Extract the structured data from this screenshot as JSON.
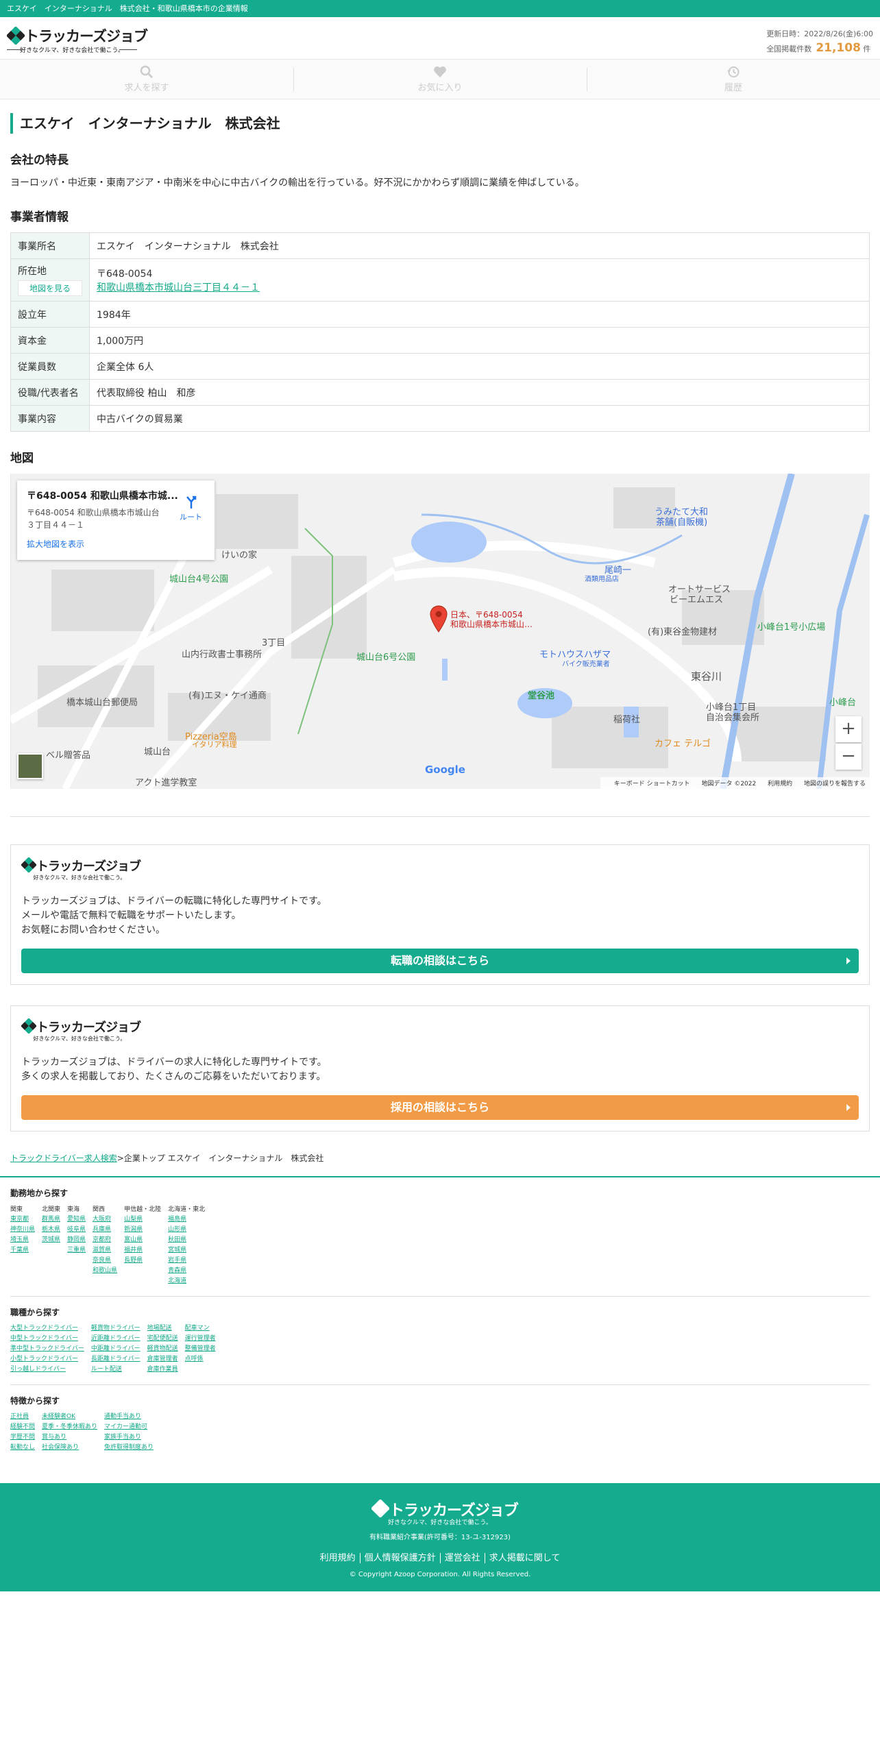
{
  "topbar": {
    "text": "エスケイ　インターナショナル　株式会社・和歌山県橋本市の企業情報"
  },
  "brand": {
    "name": "トラッカーズジョブ",
    "tagline": "好きなクルマ、好きな会社で働こう。",
    "color": "#14ab8f"
  },
  "header": {
    "updated": "更新日時：2022/8/26(金)6:00",
    "count_label": "全国掲載件数",
    "count": "21,108",
    "count_unit": "件"
  },
  "nav": {
    "search": "求人を探す",
    "favorite": "お気に入り",
    "history": "履歴"
  },
  "company": {
    "title": "エスケイ　インターナショナル　株式会社"
  },
  "features": {
    "heading": "会社の特長",
    "text": "ヨーロッパ・中近東・東南アジア・中南米を中心に中古バイクの輸出を行っている。好不況にかかわらず順調に業績を伸ばしている。"
  },
  "info": {
    "heading": "事業者情報",
    "map_button": "地図を見る",
    "rows": [
      {
        "label": "事業所名",
        "value": "エスケイ　インターナショナル　株式会社"
      },
      {
        "label": "所在地",
        "postal": "〒648-0054",
        "value": "和歌山県橋本市城山台三丁目４４－１"
      },
      {
        "label": "設立年",
        "value": "1984年"
      },
      {
        "label": "資本金",
        "value": "1,000万円"
      },
      {
        "label": "従業員数",
        "value": "企業全体 6人"
      },
      {
        "label": "役職/代表者名",
        "value": "代表取締役 柏山　和彦"
      },
      {
        "label": "事業内容",
        "value": "中古バイクの貿易業"
      }
    ]
  },
  "map": {
    "heading": "地図",
    "card_title": "〒648-0054 和歌山県橋本市城...",
    "card_address": "〒648-0054 和歌山県橋本市城山台３丁目４４－１",
    "card_link": "拡大地図を表示",
    "route": "ルート",
    "zoom_in": "+",
    "zoom_out": "−",
    "google": "Google",
    "footer": [
      "キーボード ショートカット",
      "地図データ ©2022",
      "利用規約",
      "地図の誤りを報告する"
    ],
    "marker_line1": "日本、〒648-0054",
    "marker_line2": "和歌山県橋本市城山…",
    "labels": {
      "keinoie": "けいの家",
      "park4": "城山台4号公園",
      "gyosei": "山内行政書士事務所",
      "chome3": "3丁目",
      "park6": "城山台6号公園",
      "enuke": "(有)エヌ・ケイ通商",
      "post": "橋本城山台郵便局",
      "pizzeria": "Pizzeria空島",
      "italian": "イタリア料理",
      "shiroyamadai": "城山台",
      "beru": "ベル贈答品",
      "akuto": "アクト進学教室",
      "umitate": "うみたて大和",
      "chaho": "茶舗(自販機)",
      "oozaki": "尾崎一",
      "oozaki_sub": "酒類用品店",
      "autoservice": "オートサービス",
      "biemuesu": "ビーエムエス",
      "motohouse": "モトハウスハザマ",
      "motohouse_sub": "バイク販売業者",
      "higashitani": "(有)東谷金物建材",
      "komine1park": "小峰台1号小広場",
      "doyaike": "堂谷池",
      "inari": "稲荷社",
      "higashitani_area": "東谷川",
      "kominedai": "小峰台1丁目",
      "jichikai": "自治会集会所",
      "cafe": "カフェ テルゴ",
      "komine": "小峰台"
    }
  },
  "promo1": {
    "text": [
      "トラッカーズジョブは、ドライバーの転職に特化した専門サイトです。",
      "メールや電話で無料で転職をサポートいたします。",
      "お気軽にお問い合わせください。"
    ],
    "button": "転職の相談はこちら"
  },
  "promo2": {
    "text": [
      "トラッカーズジョブは、ドライバーの求人に特化した専門サイトです。",
      "多くの求人を掲載しており、たくさんのご応募をいただいております。"
    ],
    "button": "採用の相談はこちら"
  },
  "breadcrumb": {
    "root": "トラックドライバー求人検索",
    "sep": ">",
    "current": "企業トップ エスケイ　インターナショナル　株式会社"
  },
  "area_search": {
    "heading": "勤務地から探す",
    "regions": [
      {
        "name": "関東",
        "items": [
          "東京都",
          "神奈川県",
          "埼玉県",
          "千葉県"
        ]
      },
      {
        "name": "北関東",
        "items": [
          "群馬県",
          "栃木県",
          "茨城県"
        ]
      },
      {
        "name": "東海",
        "items": [
          "愛知県",
          "岐阜県",
          "静岡県",
          "三重県"
        ]
      },
      {
        "name": "関西",
        "items": [
          "大阪府",
          "兵庫県",
          "京都府",
          "滋賀県",
          "奈良県",
          "和歌山県"
        ]
      },
      {
        "name": "甲信越・北陸",
        "items": [
          "山梨県",
          "新潟県",
          "富山県",
          "福井県",
          "長野県"
        ]
      },
      {
        "name": "北海道・東北",
        "items": [
          "福島県",
          "山形県",
          "秋田県",
          "宮城県",
          "岩手県",
          "青森県",
          "北海道"
        ]
      }
    ]
  },
  "job_search": {
    "heading": "職種から探す",
    "columns": [
      [
        "大型トラックドライバー",
        "中型トラックドライバー",
        "準中型トラックドライバー",
        "小型トラックドライバー",
        "引っ越しドライバー"
      ],
      [
        "軽貨物ドライバー",
        "近距離ドライバー",
        "中距離ドライバー",
        "長距離ドライバー",
        "ルート配送"
      ],
      [
        "地場配送",
        "宅配便配送",
        "軽貨物配送",
        "倉庫管理者",
        "倉庫作業員"
      ],
      [
        "配車マン",
        "運行管理者",
        "整備管理者",
        "点呼係"
      ]
    ]
  },
  "feature_search": {
    "heading": "特徴から探す",
    "columns": [
      [
        "正社員",
        "経験不問",
        "学歴不問",
        "転勤なし"
      ],
      [
        "未経験者OK",
        "夏季・冬季休暇あり",
        "賞与あり",
        "社会保険あり"
      ],
      [
        "通勤手当あり",
        "マイカー通勤可",
        "家族手当あり",
        "免許取得制度あり"
      ]
    ]
  },
  "footer": {
    "license": "有料職業紹介事業(許可番号：13-ユ-312923)",
    "links": [
      "利用規約",
      "個人情報保護方針",
      "運営会社",
      "求人掲載に関して"
    ],
    "copyright": "© Copyright Azoop Corporation. All Rights Reserved."
  }
}
